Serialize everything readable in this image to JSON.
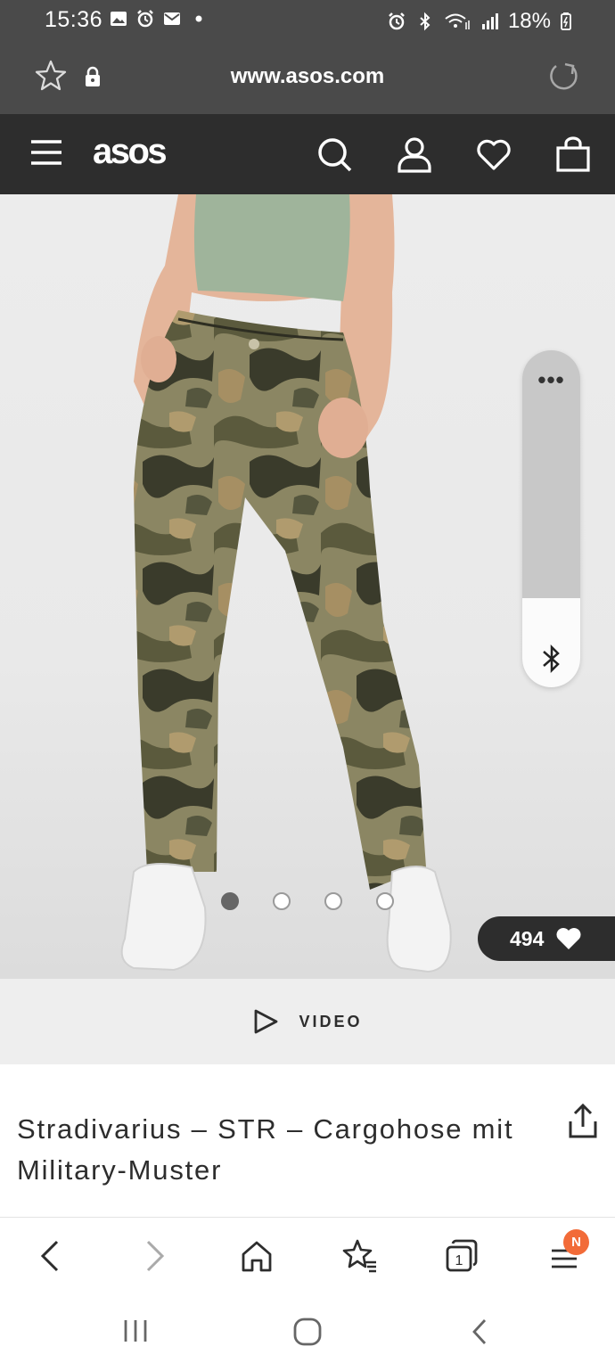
{
  "status_bar": {
    "time": "15:36",
    "battery": "18%",
    "left_icons": [
      "gallery-icon",
      "alarm-icon",
      "mail-icon",
      "dot"
    ],
    "right_icons": [
      "alarm-icon",
      "bluetooth-icon",
      "wifi-icon",
      "signal-icon",
      "battery-charging-icon"
    ]
  },
  "browser": {
    "url": "www.asos.com",
    "icons": [
      "star-icon",
      "lock-icon",
      "reload-icon"
    ]
  },
  "site_nav": {
    "logo": "asos",
    "icons": [
      "menu-icon",
      "search-icon",
      "account-icon",
      "heart-icon",
      "bag-icon"
    ]
  },
  "gallery": {
    "image_count": 4,
    "active_index": 0,
    "likes": "494"
  },
  "floating_panel": {
    "more_label": "•••",
    "icon": "bluetooth-icon"
  },
  "video": {
    "label": "VIDEO"
  },
  "product": {
    "title": "Stradivarius – STR – Cargohose mit Military-Muster"
  },
  "browser_bottom_bar": {
    "tabs_count": "1",
    "menu_badge": "N",
    "icons": [
      "back-icon",
      "forward-icon",
      "home-icon",
      "bookmarks-icon",
      "tabs-icon",
      "menu-icon"
    ]
  },
  "colors": {
    "dark_bar": "#4a4a4a",
    "asos_nav": "#2d2d2d",
    "badge": "#f26b38"
  }
}
